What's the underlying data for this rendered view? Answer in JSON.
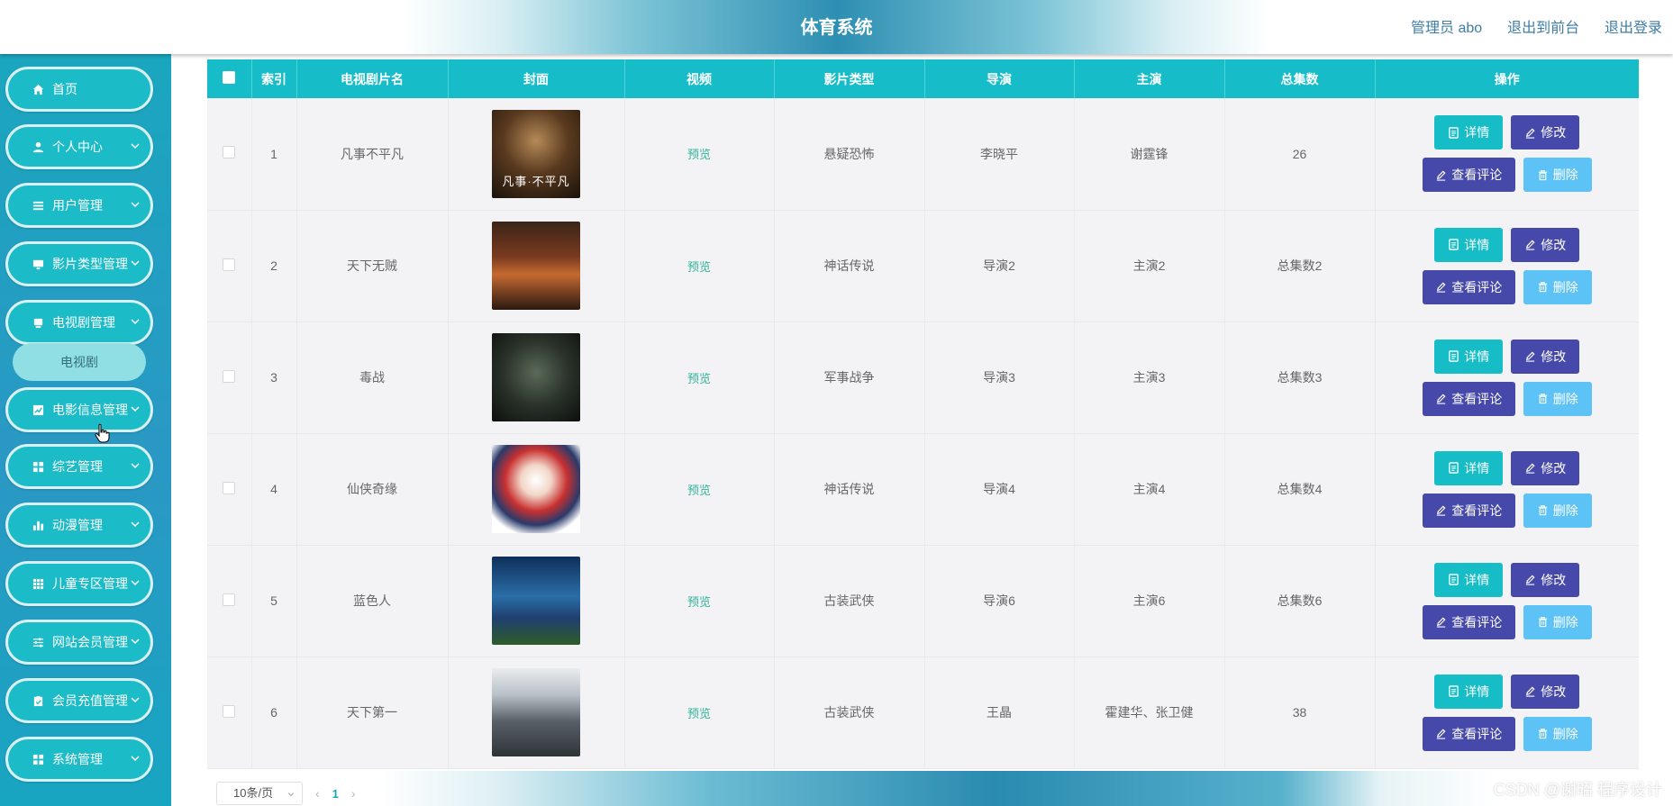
{
  "header": {
    "title": "体育系统",
    "admin_label": "管理员 abo",
    "front_link": "退出到前台",
    "logout_link": "退出登录"
  },
  "sidebar": {
    "items": [
      {
        "label": "首页",
        "icon": "home-icon"
      },
      {
        "label": "个人中心",
        "icon": "user-icon"
      },
      {
        "label": "用户管理",
        "icon": "list-icon"
      },
      {
        "label": "影片类型管理",
        "icon": "monitor-icon"
      },
      {
        "label": "电视剧管理",
        "icon": "tv-icon"
      },
      {
        "label": "电影信息管理",
        "icon": "chart-icon"
      },
      {
        "label": "综艺管理",
        "icon": "grid-icon"
      },
      {
        "label": "动漫管理",
        "icon": "bar-chart-icon"
      },
      {
        "label": "儿童专区管理",
        "icon": "table-icon"
      },
      {
        "label": "网站会员管理",
        "icon": "sliders-icon"
      },
      {
        "label": "会员充值管理",
        "icon": "clipboard-icon"
      },
      {
        "label": "系统管理",
        "icon": "grid-icon"
      }
    ],
    "submenu_label": "电视剧"
  },
  "table": {
    "headers": [
      "",
      "索引",
      "电视剧片名",
      "封面",
      "视频",
      "影片类型",
      "导演",
      "主演",
      "总集数",
      "操作"
    ],
    "rows": [
      {
        "index": "1",
        "title": "凡事不平凡",
        "cover_caption": "凡事·不平凡",
        "video": "预览",
        "genre": "悬疑恐怖",
        "director": "李晓平",
        "cast": "谢霆锋",
        "episodes": "26"
      },
      {
        "index": "2",
        "title": "天下无贼",
        "cover_caption": "",
        "video": "预览",
        "genre": "神话传说",
        "director": "导演2",
        "cast": "主演2",
        "episodes": "总集数2"
      },
      {
        "index": "3",
        "title": "毒战",
        "cover_caption": "",
        "video": "预览",
        "genre": "军事战争",
        "director": "导演3",
        "cast": "主演3",
        "episodes": "总集数3"
      },
      {
        "index": "4",
        "title": "仙侠奇缘",
        "cover_caption": "",
        "video": "预览",
        "genre": "神话传说",
        "director": "导演4",
        "cast": "主演4",
        "episodes": "总集数4"
      },
      {
        "index": "5",
        "title": "蓝色人",
        "cover_caption": "",
        "video": "预览",
        "genre": "古装武侠",
        "director": "导演6",
        "cast": "主演6",
        "episodes": "总集数6"
      },
      {
        "index": "6",
        "title": "天下第一",
        "cover_caption": "",
        "video": "预览",
        "genre": "古装武侠",
        "director": "王晶",
        "cast": "霍建华、张卫健",
        "episodes": "38"
      }
    ],
    "actions": {
      "detail": "详情",
      "edit": "修改",
      "review": "查看评论",
      "delete": "删除"
    }
  },
  "pagination": {
    "page_size": "10条/页",
    "current_page": "1"
  },
  "watermark": "CSDN @谢昭  程序设计",
  "colors": {
    "primary": "#16bdc9",
    "indigo": "#4649a9",
    "light_blue": "#5dc2f5",
    "sidebar": "#1aa6bf",
    "preview_link": "#34b39a"
  }
}
